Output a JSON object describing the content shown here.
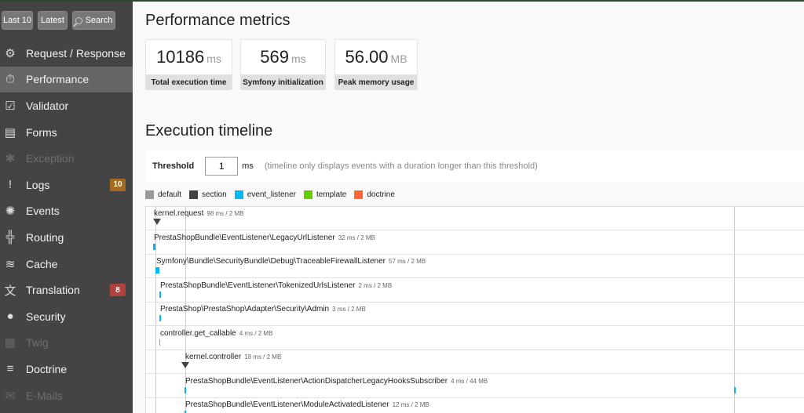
{
  "shortcuts": {
    "last10": "Last 10",
    "latest": "Latest",
    "search": "Search"
  },
  "menu": [
    {
      "label": "Request / Response",
      "icon": "gears-icon",
      "glyph": "⚙",
      "state": "normal",
      "badge": ""
    },
    {
      "label": "Performance",
      "icon": "stopwatch-icon",
      "glyph": "⏱",
      "state": "active",
      "badge": ""
    },
    {
      "label": "Validator",
      "icon": "checkbox-icon",
      "glyph": "☑",
      "state": "normal",
      "badge": ""
    },
    {
      "label": "Forms",
      "icon": "form-icon",
      "glyph": "▤",
      "state": "normal",
      "badge": ""
    },
    {
      "label": "Exception",
      "icon": "bug-icon",
      "glyph": "✱",
      "state": "disabled",
      "badge": ""
    },
    {
      "label": "Logs",
      "icon": "logs-icon",
      "glyph": "!",
      "state": "normal",
      "badge": "10",
      "badge_color": "#a46a1f"
    },
    {
      "label": "Events",
      "icon": "events-icon",
      "glyph": "✺",
      "state": "normal",
      "badge": ""
    },
    {
      "label": "Routing",
      "icon": "routing-icon",
      "glyph": "╬",
      "state": "normal",
      "badge": ""
    },
    {
      "label": "Cache",
      "icon": "layers-icon",
      "glyph": "≋",
      "state": "normal",
      "badge": ""
    },
    {
      "label": "Translation",
      "icon": "translation-icon",
      "glyph": "文",
      "state": "normal",
      "badge": "8",
      "badge_color": "#b0413e"
    },
    {
      "label": "Security",
      "icon": "user-icon",
      "glyph": "●",
      "state": "normal",
      "badge": ""
    },
    {
      "label": "Twig",
      "icon": "twig-icon",
      "glyph": "▦",
      "state": "disabled",
      "badge": ""
    },
    {
      "label": "Doctrine",
      "icon": "database-icon",
      "glyph": "≡",
      "state": "normal",
      "badge": ""
    },
    {
      "label": "E-Mails",
      "icon": "envelope-icon",
      "glyph": "✉",
      "state": "disabled",
      "badge": ""
    }
  ],
  "performance": {
    "title": "Performance metrics",
    "metrics": [
      {
        "value": "10186",
        "unit": "ms",
        "label": "Total execution time"
      },
      {
        "value": "569",
        "unit": "ms",
        "label": "Symfony initialization"
      },
      {
        "value": "56.00",
        "unit": "MB",
        "label": "Peak memory usage"
      }
    ]
  },
  "timeline": {
    "title": "Execution timeline",
    "threshold_label": "Threshold",
    "threshold_value": "1",
    "threshold_unit": "ms",
    "threshold_hint": "(timeline only displays events with a duration longer than this threshold)",
    "legend": [
      {
        "label": "default",
        "color": "#999999"
      },
      {
        "label": "section",
        "color": "#444444"
      },
      {
        "label": "event_listener",
        "color": "#00B8F5"
      },
      {
        "label": "template",
        "color": "#66CC00"
      },
      {
        "label": "doctrine",
        "color": "#FF6633"
      }
    ],
    "events": [
      {
        "name": "kernel.request",
        "meta": "98 ms / 2 MB",
        "category": "section"
      },
      {
        "name": "PrestaShopBundle\\EventListener\\LegacyUrlListener",
        "meta": "32 ms / 2 MB",
        "category": "event_listener"
      },
      {
        "name": "Symfony\\Bundle\\SecurityBundle\\Debug\\TraceableFirewallListener",
        "meta": "57 ms / 2 MB",
        "category": "event_listener"
      },
      {
        "name": "PrestaShopBundle\\EventListener\\TokenizedUrlsListener",
        "meta": "2 ms / 2 MB",
        "category": "event_listener"
      },
      {
        "name": "PrestaShop\\PrestaShop\\Adapter\\Security\\Admin",
        "meta": "3 ms / 2 MB",
        "category": "event_listener"
      },
      {
        "name": "controller.get_callable",
        "meta": "4 ms / 2 MB",
        "category": "default"
      },
      {
        "name": "kernel.controller",
        "meta": "18 ms / 2 MB",
        "category": "section"
      },
      {
        "name": "PrestaShopBundle\\EventListener\\ActionDispatcherLegacyHooksSubscriber",
        "meta": "4 ms / 44 MB",
        "category": "event_listener"
      },
      {
        "name": "PrestaShopBundle\\EventListener\\ModuleActivatedListener",
        "meta": "12 ms / 2 MB",
        "category": "event_listener"
      }
    ]
  }
}
